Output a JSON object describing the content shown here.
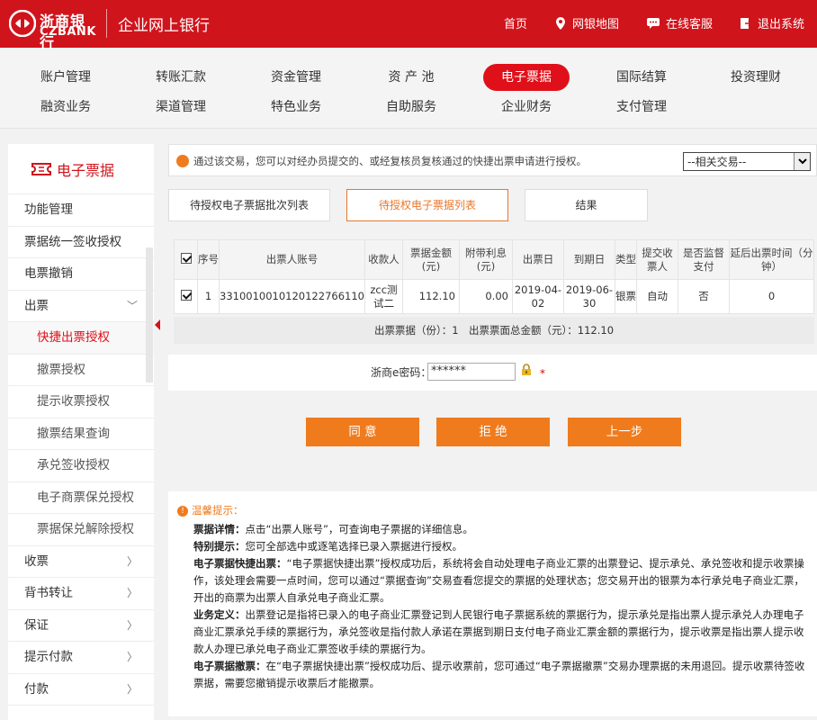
{
  "brand": {
    "cn": "浙商银行",
    "en": "CZBANK",
    "app_title": "企业网上银行"
  },
  "top_links": [
    "首页",
    "网银地图",
    "在线客服",
    "退出系统"
  ],
  "nav": {
    "row1": [
      "账户管理",
      "转账汇款",
      "资金管理",
      "资 产 池",
      "电子票据",
      "国际结算",
      "投资理财"
    ],
    "row2": [
      "融资业务",
      "渠道管理",
      "特色业务",
      "自助服务",
      "企业财务",
      "支付管理"
    ],
    "active": "电子票据"
  },
  "sidebar": {
    "title": "电子票据",
    "items": [
      {
        "label": "功能管理",
        "sub": false,
        "arrow": ""
      },
      {
        "label": "票据统一签收授权",
        "sub": false,
        "arrow": ""
      },
      {
        "label": "电票撤销",
        "sub": false,
        "arrow": ""
      },
      {
        "label": "出票",
        "sub": false,
        "arrow": "﹀"
      },
      {
        "label": "快捷出票授权",
        "sub": true,
        "arrow": "",
        "current": true
      },
      {
        "label": "撤票授权",
        "sub": true,
        "arrow": ""
      },
      {
        "label": "提示收票授权",
        "sub": true,
        "arrow": ""
      },
      {
        "label": "撤票结果查询",
        "sub": true,
        "arrow": ""
      },
      {
        "label": "承兑签收授权",
        "sub": true,
        "arrow": ""
      },
      {
        "label": "电子商票保兑授权",
        "sub": true,
        "arrow": ""
      },
      {
        "label": "票据保兑解除授权",
        "sub": true,
        "arrow": ""
      },
      {
        "label": "收票",
        "sub": false,
        "arrow": "〉"
      },
      {
        "label": "背书转让",
        "sub": false,
        "arrow": "〉"
      },
      {
        "label": "保证",
        "sub": false,
        "arrow": "〉"
      },
      {
        "label": "提示付款",
        "sub": false,
        "arrow": "〉"
      },
      {
        "label": "付款",
        "sub": false,
        "arrow": "〉"
      }
    ]
  },
  "notice": "通过该交易，您可以对经办员提交的、或经复核员复核通过的快捷出票申请进行授权。",
  "related_select": "--相关交易--",
  "tabs": [
    "待授权电子票据批次列表",
    "待授权电子票据列表",
    "结果"
  ],
  "active_tab": 1,
  "table": {
    "headers": [
      "序号",
      "出票人账号",
      "收款人",
      "票据金额(元)",
      "附带利息(元)",
      "出票日",
      "到期日",
      "类型",
      "提交收票人",
      "是否监督支付",
      "延后出票时间（分钟）"
    ],
    "rows": [
      {
        "seq": "1",
        "account": "3310010010120122766110",
        "payee": "zcc测试二",
        "amount": "112.10",
        "interest": "0.00",
        "issue_date": "2019-04-02",
        "due_date": "2019-06-30",
        "type": "银票",
        "submit": "自动",
        "supervise": "否",
        "delay": "0",
        "checked": true
      }
    ]
  },
  "summary": "出票票据（份）：1　出票票面总金额（元）：112.10",
  "password": {
    "label": "浙商e密码：",
    "value": "******"
  },
  "buttons": {
    "agree": "同 意",
    "reject": "拒 绝",
    "back": "上一步"
  },
  "tips": {
    "title": "温馨提示：",
    "items": [
      {
        "head": "票据详情：",
        "text": "点击“出票人账号”，可查询电子票据的详细信息。"
      },
      {
        "head": "特别提示：",
        "text": "您可全部选中或逐笔选择已录入票据进行授权。"
      },
      {
        "head": "电子票据快捷出票：",
        "text": "“电子票据快捷出票”授权成功后，系统将会自动处理电子商业汇票的出票登记、提示承兑、承兑签收和提示收票操作，该处理会需要一点时间，您可以通过“票据查询”交易查看您提交的票据的处理状态；您交易开出的银票为本行承兑电子商业汇票，开出的商票为出票人自承兑电子商业汇票。"
      },
      {
        "head": "业务定义：",
        "text": "出票登记是指将已录入的电子商业汇票登记到人民银行电子票据系统的票据行为，提示承兑是指出票人提示承兑人办理电子商业汇票承兑手续的票据行为，承兑签收是指付款人承诺在票据到期日支付电子商业汇票金额的票据行为，提示收票是指出票人提示收款人办理已承兑电子商业汇票签收手续的票据行为。"
      },
      {
        "head": "电子票据撤票：",
        "text": "在“电子票据快捷出票”授权成功后、提示收票前，您可通过“电子票据撤票”交易办理票据的未用退回。提示收票待签收票据，需要您撤销提示收票后才能撤票。"
      }
    ]
  },
  "colors": {
    "brand_red": "#d0141c",
    "accent_orange": "#f07b1d"
  }
}
